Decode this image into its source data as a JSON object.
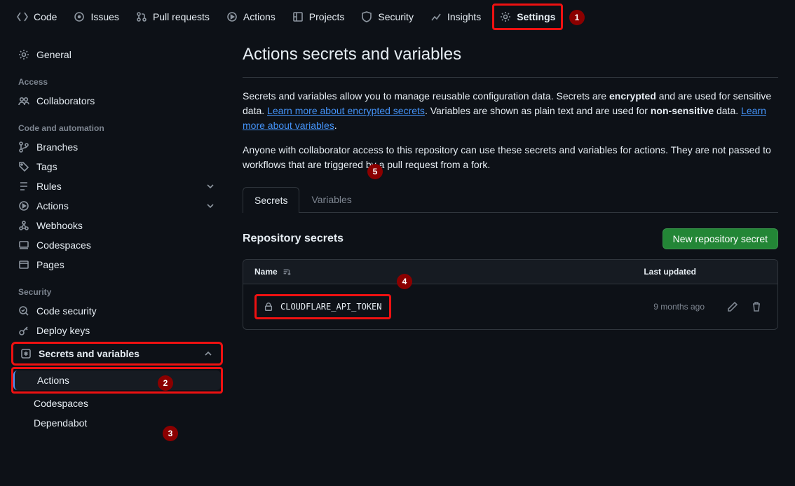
{
  "topnav": {
    "code": "Code",
    "issues": "Issues",
    "pulls": "Pull requests",
    "actions": "Actions",
    "projects": "Projects",
    "security": "Security",
    "insights": "Insights",
    "settings": "Settings"
  },
  "sidebar": {
    "general": "General",
    "head_access": "Access",
    "collaborators": "Collaborators",
    "head_code_auto": "Code and automation",
    "branches": "Branches",
    "tags": "Tags",
    "rules": "Rules",
    "actions": "Actions",
    "webhooks": "Webhooks",
    "codespaces": "Codespaces",
    "pages": "Pages",
    "head_security": "Security",
    "code_security": "Code security",
    "deploy_keys": "Deploy keys",
    "secrets_vars": "Secrets and variables",
    "sub_actions": "Actions",
    "sub_codespaces": "Codespaces",
    "sub_dependabot": "Dependabot"
  },
  "page": {
    "title": "Actions secrets and variables",
    "intro_p1a": "Secrets and variables allow you to manage reusable configuration data. Secrets are ",
    "intro_p1b": "encrypted",
    "intro_p1c": " and are used for sensitive data. ",
    "intro_link1": "Learn more about encrypted secrets",
    "intro_p1d": ". Variables are shown as plain text and are used for ",
    "intro_p1e": "non-sensitive",
    "intro_p1f": " data. ",
    "intro_link2": "Learn more about variables",
    "intro_p1g": ".",
    "intro_p2": "Anyone with collaborator access to this repository can use these secrets and variables for actions. They are not passed to workflows that are triggered by a pull request from a fork."
  },
  "tabs": {
    "secrets": "Secrets",
    "variables": "Variables"
  },
  "repo_secrets": {
    "heading": "Repository secrets",
    "new_btn": "New repository secret",
    "col_name": "Name",
    "col_updated": "Last updated",
    "rows": [
      {
        "name": "CLOUDFLARE_API_TOKEN",
        "updated": "9 months ago"
      }
    ]
  },
  "annotations": {
    "n1": "1",
    "n2": "2",
    "n3": "3",
    "n4": "4",
    "n5": "5"
  }
}
